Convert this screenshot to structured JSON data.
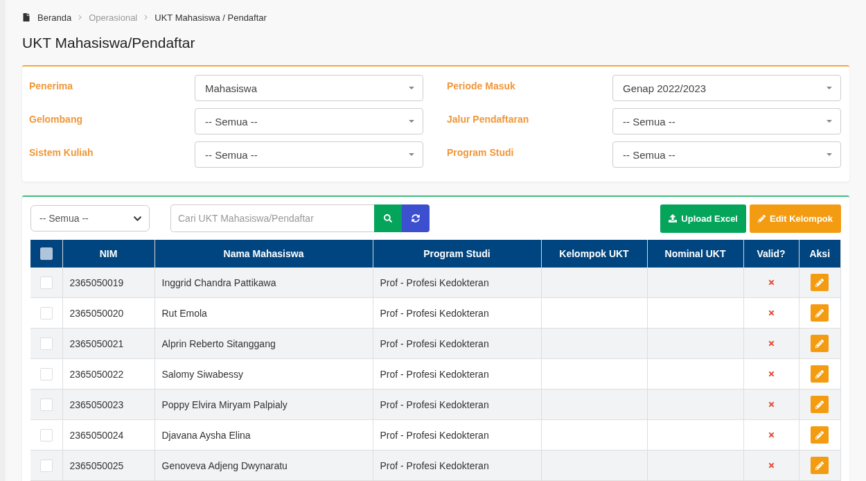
{
  "breadcrumb": [
    {
      "label": "Beranda",
      "active": true
    },
    {
      "label": "Operasional",
      "active": false
    },
    {
      "label": "UKT Mahasiswa / Pendaftar",
      "active": true
    }
  ],
  "page_title": "UKT Mahasiswa/Pendaftar",
  "filters": [
    {
      "label": "Penerima",
      "value": "Mahasiswa"
    },
    {
      "label": "Periode Masuk",
      "value": "Genap 2022/2023"
    },
    {
      "label": "Gelombang",
      "value": "-- Semua --"
    },
    {
      "label": "Jalur Pendaftaran",
      "value": "-- Semua --"
    },
    {
      "label": "Sistem Kuliah",
      "value": "-- Semua --"
    },
    {
      "label": "Program Studi",
      "value": "-- Semua --"
    }
  ],
  "toolbar": {
    "status_select": "-- Semua --",
    "search": {
      "placeholder": "Cari UKT Mahasiswa/Pendaftar"
    },
    "buttons": [
      {
        "label": "Upload Excel",
        "kind": "upload"
      },
      {
        "label": "Edit Kelompok",
        "kind": "edit"
      }
    ]
  },
  "table": {
    "select_all": {
      "checked": false
    },
    "columns": [
      "NIM",
      "Nama Mahasiswa",
      "Program Studi",
      "Kelompok UKT",
      "Nominal UKT",
      "Valid?",
      "Aksi"
    ],
    "rows": [
      {
        "checked": false,
        "nim": "2365050019",
        "nama": "Inggrid Chandra Pattikawa",
        "prodi": "Prof - Profesi Kedokteran",
        "valid": false
      },
      {
        "checked": false,
        "nim": "2365050020",
        "nama": "Rut Emola",
        "prodi": "Prof - Profesi Kedokteran",
        "valid": false
      },
      {
        "checked": false,
        "nim": "2365050021",
        "nama": "Alprin Reberto Sitanggang",
        "prodi": "Prof - Profesi Kedokteran",
        "valid": false
      },
      {
        "checked": false,
        "nim": "2365050022",
        "nama": "Salomy Siwabessy",
        "prodi": "Prof - Profesi Kedokteran",
        "valid": false
      },
      {
        "checked": false,
        "nim": "2365050023",
        "nama": "Poppy Elvira Miryam Palpialy",
        "prodi": "Prof - Profesi Kedokteran",
        "valid": false
      },
      {
        "checked": false,
        "nim": "2365050024",
        "nama": "Djavana Aysha Elina",
        "prodi": "Prof - Profesi Kedokteran",
        "valid": false
      },
      {
        "checked": false,
        "nim": "2365050025",
        "nama": "Genoveva Adjeng Dwynaratu",
        "prodi": "Prof - Profesi Kedokteran",
        "valid": false
      }
    ]
  }
}
